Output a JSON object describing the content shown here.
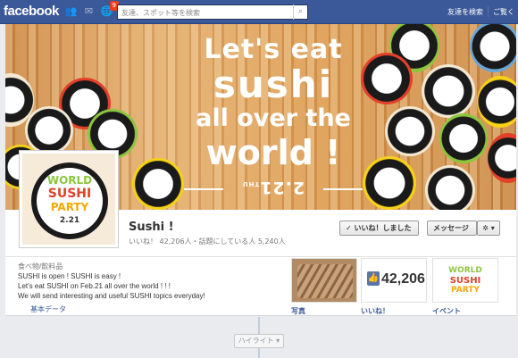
{
  "topbar": {
    "logo": "facebook",
    "notification_count": "9",
    "search_placeholder": "友達、スポット等を検索",
    "links": [
      "友達を検索",
      "ご覧く"
    ]
  },
  "cover": {
    "line1": "Let's eat",
    "line2": "sushi",
    "line3": "all over the",
    "line4": "world !",
    "date": "2.21",
    "date_suffix": "THU"
  },
  "profile": {
    "logo_lines": [
      "WORLD",
      "SUSHI",
      "PARTY"
    ],
    "logo_date": "2.21"
  },
  "header": {
    "name": "Sushi !",
    "stats": "いいね！ 42,206人・話題にしている人 5,240人",
    "like_button": "いいね！しました",
    "message_button": "メッセージ",
    "gear_button": "✲ ▾"
  },
  "about": {
    "category": "食べ物/飲料品",
    "lines": [
      "SUSHI is open ! SUSHI is easy !",
      "Let's eat SUSHI on Feb.21 all over the world ! ! !",
      "We will send interesting and useful SUSHI topics everyday!"
    ],
    "link": "基本データ"
  },
  "tiles": {
    "photos_label": "写真",
    "likes_count": "42,206",
    "likes_label": "いいね！",
    "event_label": "イベント",
    "event_logo": [
      "WORLD",
      "SUSHI",
      "PARTY"
    ]
  },
  "timeline": {
    "highlight": "ハイライト ▾"
  },
  "colors": {
    "fb_blue": "#3b5998",
    "link": "#3b5998",
    "sushi_green": "#8cc63f",
    "sushi_red": "#e2402a",
    "sushi_yellow": "#f7d117"
  }
}
